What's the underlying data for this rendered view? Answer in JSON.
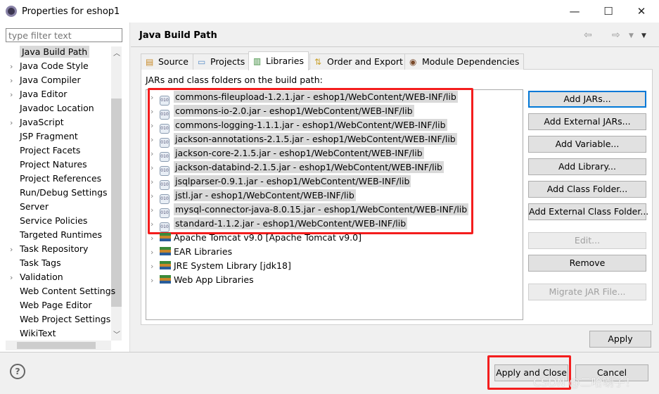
{
  "window": {
    "title": "Properties for eshop1",
    "minimize": "—",
    "maximize": "☐",
    "close": "✕"
  },
  "sidebar": {
    "filter_placeholder": "type filter text",
    "items": [
      {
        "label": "Java Build Path",
        "expandable": false,
        "selected": true
      },
      {
        "label": "Java Code Style",
        "expandable": true
      },
      {
        "label": "Java Compiler",
        "expandable": true
      },
      {
        "label": "Java Editor",
        "expandable": true
      },
      {
        "label": "Javadoc Location",
        "expandable": false
      },
      {
        "label": "JavaScript",
        "expandable": true
      },
      {
        "label": "JSP Fragment",
        "expandable": false
      },
      {
        "label": "Project Facets",
        "expandable": false
      },
      {
        "label": "Project Natures",
        "expandable": false
      },
      {
        "label": "Project References",
        "expandable": false
      },
      {
        "label": "Run/Debug Settings",
        "expandable": false
      },
      {
        "label": "Server",
        "expandable": false
      },
      {
        "label": "Service Policies",
        "expandable": false
      },
      {
        "label": "Targeted Runtimes",
        "expandable": false
      },
      {
        "label": "Task Repository",
        "expandable": true
      },
      {
        "label": "Task Tags",
        "expandable": false
      },
      {
        "label": "Validation",
        "expandable": true
      },
      {
        "label": "Web Content Settings",
        "expandable": false
      },
      {
        "label": "Web Page Editor",
        "expandable": false
      },
      {
        "label": "Web Project Settings",
        "expandable": false
      },
      {
        "label": "WikiText",
        "expandable": false
      }
    ]
  },
  "page": {
    "title": "Java Build Path",
    "tabs": [
      {
        "label": "Source",
        "icon": "source-folder-icon"
      },
      {
        "label": "Projects",
        "icon": "folder-icon"
      },
      {
        "label": "Libraries",
        "icon": "libraries-icon",
        "active": true
      },
      {
        "label": "Order and Export",
        "icon": "order-icon"
      },
      {
        "label": "Module Dependencies",
        "icon": "module-icon"
      }
    ],
    "list_label": "JARs and class folders on the build path:",
    "entries": [
      {
        "label": "commons-fileupload-1.2.1.jar - eshop1/WebContent/WEB-INF/lib",
        "type": "jar"
      },
      {
        "label": "commons-io-2.0.jar - eshop1/WebContent/WEB-INF/lib",
        "type": "jar"
      },
      {
        "label": "commons-logging-1.1.1.jar - eshop1/WebContent/WEB-INF/lib",
        "type": "jar"
      },
      {
        "label": "jackson-annotations-2.1.5.jar - eshop1/WebContent/WEB-INF/lib",
        "type": "jar"
      },
      {
        "label": "jackson-core-2.1.5.jar - eshop1/WebContent/WEB-INF/lib",
        "type": "jar"
      },
      {
        "label": "jackson-databind-2.1.5.jar - eshop1/WebContent/WEB-INF/lib",
        "type": "jar"
      },
      {
        "label": "jsqlparser-0.9.1.jar - eshop1/WebContent/WEB-INF/lib",
        "type": "jar"
      },
      {
        "label": "jstl.jar - eshop1/WebContent/WEB-INF/lib",
        "type": "jar"
      },
      {
        "label": "mysql-connector-java-8.0.15.jar - eshop1/WebContent/WEB-INF/lib",
        "type": "jar"
      },
      {
        "label": "standard-1.1.2.jar - eshop1/WebContent/WEB-INF/lib",
        "type": "jar"
      },
      {
        "label": "Apache Tomcat v9.0 [Apache Tomcat v9.0]",
        "type": "library"
      },
      {
        "label": "EAR Libraries",
        "type": "library"
      },
      {
        "label": "JRE System Library [jdk18]",
        "type": "library"
      },
      {
        "label": "Web App Libraries",
        "type": "library"
      }
    ],
    "buttons": [
      {
        "label": "Add JARs...",
        "enabled": true,
        "default": true
      },
      {
        "label": "Add External JARs...",
        "enabled": true
      },
      {
        "label": "Add Variable...",
        "enabled": true
      },
      {
        "label": "Add Library...",
        "enabled": true
      },
      {
        "label": "Add Class Folder...",
        "enabled": true
      },
      {
        "label": "Add External Class Folder...",
        "enabled": true
      },
      {
        "label": "Edit...",
        "enabled": false
      },
      {
        "label": "Remove",
        "enabled": true
      },
      {
        "label": "Migrate JAR File...",
        "enabled": false
      }
    ],
    "apply": "Apply"
  },
  "footer": {
    "help": "?",
    "apply_close": "Apply and Close",
    "cancel": "Cancel"
  },
  "watermark": "CSDN @二哈喇子！",
  "colors": {
    "highlight_box": "#f41d1d",
    "selection": "#d9d9d9",
    "default_button_border": "#0078d7"
  }
}
